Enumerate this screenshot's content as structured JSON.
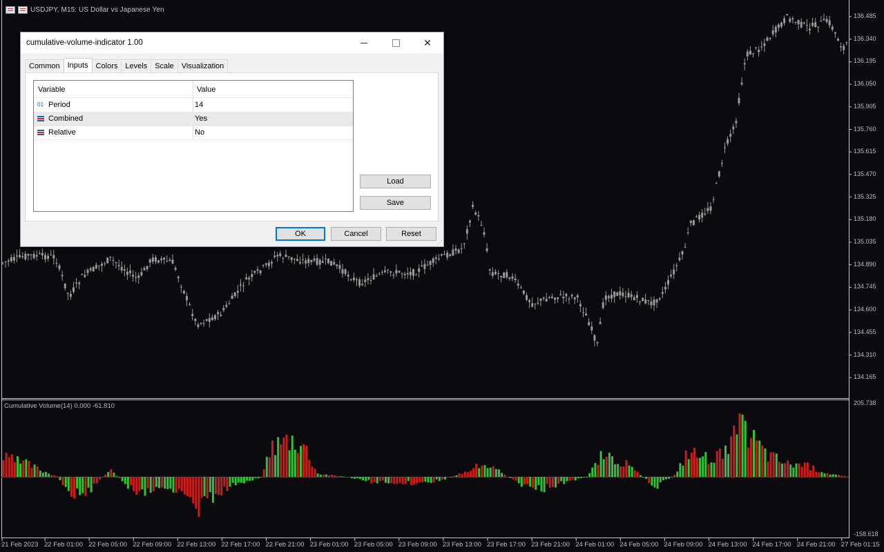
{
  "chart": {
    "title": "USDJPY, M15:  US Dollar vs Japanese Yen",
    "price_labels": [
      "136.485",
      "136.340",
      "136.195",
      "136.050",
      "135.905",
      "135.760",
      "135.615",
      "135.470",
      "135.325",
      "135.180",
      "135.035",
      "134.890",
      "134.745",
      "134.600",
      "134.455",
      "134.310",
      "134.165"
    ],
    "subwindow_label": "Cumulative Volume(14) 0.000 -61.810",
    "sub_scale": [
      "205.738",
      "-158.618"
    ],
    "time_labels": [
      "21 Feb 2023",
      "22 Feb 01:00",
      "22 Feb 05:00",
      "22 Feb 09:00",
      "22 Feb 13:00",
      "22 Feb 17:00",
      "22 Feb 21:00",
      "23 Feb 01:00",
      "23 Feb 05:00",
      "23 Feb 09:00",
      "23 Feb 13:00",
      "23 Feb 17:00",
      "23 Feb 21:00",
      "24 Feb 01:00",
      "24 Feb 05:00",
      "24 Feb 09:00",
      "24 Feb 13:00",
      "24 Feb 17:00",
      "24 Feb 21:00",
      "27 Feb 01:15"
    ],
    "colors": {
      "background": "#0a0a0f",
      "candle": "#9a9a9a",
      "up_bar": "#33c13a",
      "down_bar": "#c4201e"
    }
  },
  "dialog": {
    "title": "cumulative-volume-indicator 1.00",
    "tabs": [
      "Common",
      "Inputs",
      "Colors",
      "Levels",
      "Scale",
      "Visualization"
    ],
    "active_tab": "Inputs",
    "grid": {
      "headers": [
        "Variable",
        "Value"
      ],
      "rows": [
        {
          "icon": "int-param-icon",
          "icon_text": "01",
          "name": "Period",
          "value": "14"
        },
        {
          "icon": "enum-param-icon",
          "name": "Combined",
          "value": "Yes"
        },
        {
          "icon": "enum-param-icon",
          "name": "Relative",
          "value": "No"
        }
      ]
    },
    "buttons": {
      "load": "Load",
      "save": "Save",
      "ok": "OK",
      "cancel": "Cancel",
      "reset": "Reset"
    },
    "window_controls": {
      "close": "✕"
    }
  }
}
